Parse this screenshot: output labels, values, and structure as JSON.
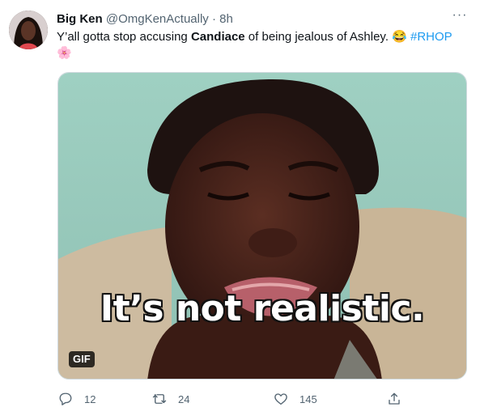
{
  "tweet": {
    "display_name": "Big Ken",
    "handle": "@OmgKenActually",
    "separator": "·",
    "time": "8h",
    "more_label": "···",
    "text_part1": "Y’all gotta stop accusing ",
    "text_bold": "Candiace",
    "text_part2": " of being jealous of Ashley. 😂 ",
    "hashtag": "#RHOP",
    "emoji_line": "🌸",
    "media": {
      "caption": "It’s not realistic.",
      "badge": "GIF"
    },
    "actions": {
      "replies": "12",
      "retweets": "24",
      "likes": "145"
    }
  },
  "icons": [
    "reply-icon",
    "retweet-icon",
    "like-icon",
    "share-icon",
    "more-icon"
  ],
  "colors": {
    "link": "#1d9bf0",
    "secondary_text": "#536471",
    "primary_text": "#0f1419"
  }
}
